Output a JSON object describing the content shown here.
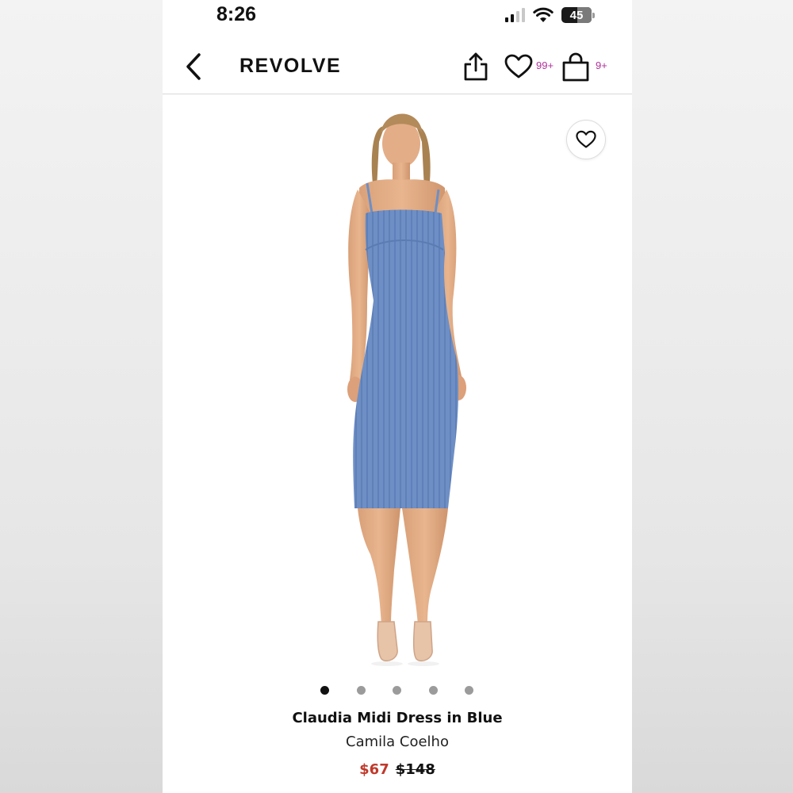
{
  "status_bar": {
    "time": "8:26",
    "battery": "45"
  },
  "nav": {
    "brand": "REVOLVE",
    "wishlist_count": "99+",
    "bag_count": "9+"
  },
  "icons": {
    "back": "chevron-left-icon",
    "share": "share-icon",
    "wishlist": "heart-icon",
    "bag": "shopping-bag-icon",
    "favorite": "heart-icon"
  },
  "product": {
    "name": "Claudia Midi Dress in Blue",
    "designer": "Camila Coelho",
    "sale_price": "$67",
    "original_price": "$148",
    "image_count": 5,
    "active_image_index": 0
  },
  "colors": {
    "accent_count": "#b0319b",
    "sale_price": "#c0392b",
    "dress": "#6d8fc4"
  }
}
